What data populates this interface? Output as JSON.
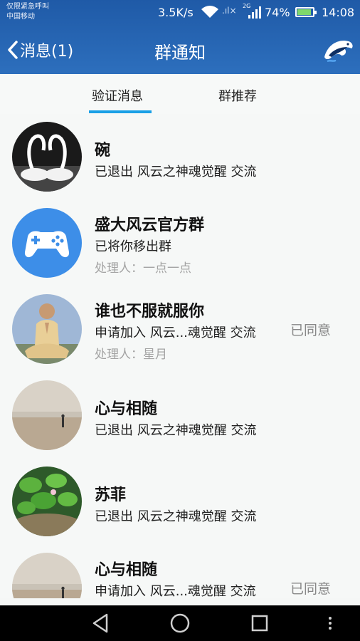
{
  "status_bar": {
    "carrier_line1": "仅限紧急呼叫",
    "carrier_line2": "中国移动",
    "net_speed": "3.5K/s",
    "network_type": "2G",
    "battery": "74%",
    "time": "14:08"
  },
  "header": {
    "back_label": "消息(1)",
    "title": "群通知"
  },
  "tabs": [
    {
      "label": "验证消息",
      "active": true
    },
    {
      "label": "群推荐",
      "active": false
    }
  ],
  "notifications": [
    {
      "name": "碗",
      "message": "已退出 风云之神魂觉醒 交流"
    },
    {
      "name": "盛大风云官方群",
      "message": "已将你移出群",
      "handler": "处理人：一点一点"
    },
    {
      "name": "谁也不服就服你",
      "message": "申请加入 风云...魂觉醒 交流",
      "handler": "处理人：星月",
      "status": "已同意"
    },
    {
      "name": "心与相随",
      "message": "已退出 风云之神魂觉醒 交流"
    },
    {
      "name": "苏菲",
      "message": "已退出 风云之神魂觉醒 交流"
    },
    {
      "name": "心与相随",
      "message": "申请加入 风云...魂觉醒 交流",
      "status": "已同意"
    }
  ],
  "colors": {
    "header": "#2563b0",
    "tab_indicator": "#1aa0e6"
  }
}
